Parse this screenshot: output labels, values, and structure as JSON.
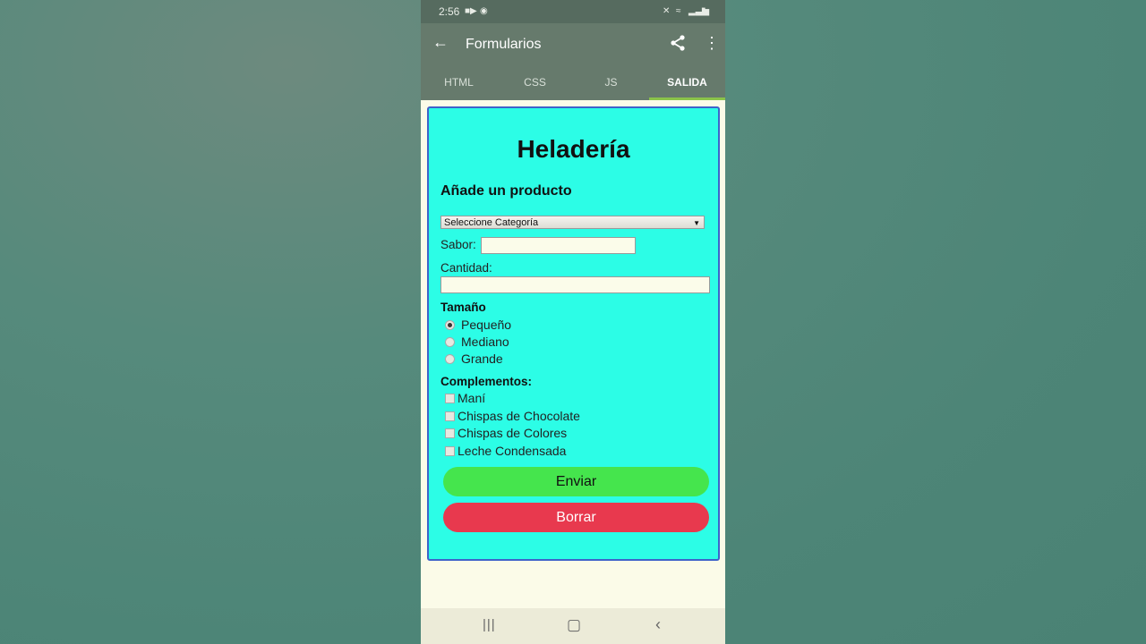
{
  "status_bar": {
    "time": "2:56"
  },
  "app_bar": {
    "title": "Formularios"
  },
  "tabs": [
    {
      "label": "HTML",
      "active": false
    },
    {
      "label": "CSS",
      "active": false
    },
    {
      "label": "JS",
      "active": false
    },
    {
      "label": "SALIDA",
      "active": true
    }
  ],
  "form": {
    "heading": "Heladería",
    "subheading": "Añade un producto",
    "category_select": {
      "selected": "Seleccione Categoría"
    },
    "flavor": {
      "label": "Sabor:",
      "value": ""
    },
    "quantity": {
      "label": "Cantidad:",
      "value": ""
    },
    "size": {
      "legend": "Tamaño",
      "options": [
        {
          "label": "Pequeño",
          "checked": true
        },
        {
          "label": "Mediano",
          "checked": false
        },
        {
          "label": "Grande",
          "checked": false
        }
      ]
    },
    "toppings": {
      "legend": "Complementos:",
      "options": [
        {
          "label": "Maní",
          "checked": false
        },
        {
          "label": "Chispas de Chocolate",
          "checked": false
        },
        {
          "label": "Chispas de Colores",
          "checked": false
        },
        {
          "label": "Leche Condensada",
          "checked": false
        }
      ]
    },
    "submit_label": "Enviar",
    "reset_label": "Borrar"
  },
  "colors": {
    "card_bg": "#2cfde6",
    "card_border": "#3f63c9",
    "submit_bg": "#45e54d",
    "reset_bg": "#e8394e",
    "tab_indicator": "#8bc34a",
    "app_bar_bg": "#667a6c"
  }
}
